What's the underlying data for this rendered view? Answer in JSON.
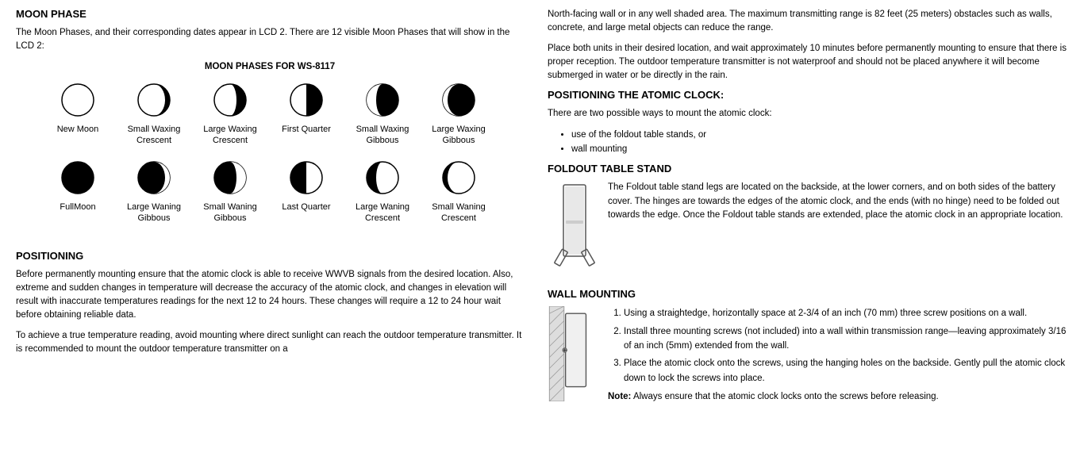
{
  "left": {
    "moon_phase_title": "MOON PHASE",
    "moon_phase_intro": "The Moon Phases, and their corresponding dates appear in LCD 2.  There are 12 visible Moon Phases that will show in the LCD 2:",
    "moon_phases_subtitle": "MOON PHASES FOR WS-8117",
    "moon_phases": [
      {
        "label": "New Moon",
        "type": "new-moon"
      },
      {
        "label": "Small Waxing Crescent",
        "type": "small-waxing-crescent"
      },
      {
        "label": "Large Waxing Crescent",
        "type": "large-waxing-crescent"
      },
      {
        "label": "First Quarter",
        "type": "first-quarter"
      },
      {
        "label": "Small Waxing Gibbous",
        "type": "small-waxing-gibbous"
      },
      {
        "label": "Large Waxing Gibbous",
        "type": "large-waxing-gibbous"
      },
      {
        "label": "FullMoon",
        "type": "full-moon"
      },
      {
        "label": "Large Waning Gibbous",
        "type": "large-waning-gibbous"
      },
      {
        "label": "Small Waning Gibbous",
        "type": "small-waning-gibbous"
      },
      {
        "label": "Last Quarter",
        "type": "last-quarter"
      },
      {
        "label": "Large Waning Crescent",
        "type": "large-waning-crescent"
      },
      {
        "label": "Small Waning Crescent",
        "type": "small-waning-crescent"
      }
    ],
    "positioning_title": "POSITIONING",
    "positioning_para1": "Before permanently mounting ensure that the atomic clock is able to receive WWVB signals from the desired location. Also, extreme and sudden changes in temperature will decrease the accuracy of the atomic clock, and changes in elevation will result with inaccurate temperatures readings for the next 12 to 24 hours. These changes will require a 12  to 24 hour wait before obtaining reliable data.",
    "positioning_para2": "To achieve a true temperature reading, avoid mounting where direct sunlight can reach the outdoor temperature transmitter. It is  recommended to mount the outdoor temperature transmitter on a"
  },
  "right": {
    "para1": "North-facing wall or in any well shaded area. The maximum transmitting range is 82 feet (25 meters) obstacles such as walls, concrete, and large metal objects can reduce the range.",
    "para2": "Place both units in their desired location, and wait approximately 10 minutes before permanently mounting to ensure that there is proper reception.  The outdoor temperature transmitter is not waterproof and should not be placed anywhere it will become submerged in water or be directly in the rain.",
    "positioning_clock_title": "POSITIONING THE ATOMIC CLOCK:",
    "positioning_clock_intro": "There are two possible ways to mount the atomic clock:",
    "positioning_clock_bullets": [
      "use of the foldout table stands, or",
      "wall mounting"
    ],
    "foldout_title": "FOLDOUT TABLE STAND",
    "foldout_desc": "The Foldout table stand legs are located on the backside, at the lower corners, and on both sides of the battery cover. The hinges are towards the edges of the  atomic clock, and the ends (with no hinge) need to be folded out towards the edge. Once the Foldout table stands are extended, place the atomic clock in an appropriate location.",
    "wall_title": "WALL MOUNTING",
    "wall_steps": [
      "Using a straightedge, horizontally space at 2-3/4 of an inch (70 mm) three screw positions on a wall.",
      "Install three mounting screws (not included) into a wall within transmission range—leaving approximately 3/16 of an inch (5mm) extended from the wall.",
      "Place the atomic clock onto the screws, using the hanging holes on the backside. Gently pull the atomic clock down to lock the screws into place."
    ],
    "wall_note_label": "Note:",
    "wall_note_text": "Always ensure that the atomic clock locks onto the screws before releasing."
  }
}
